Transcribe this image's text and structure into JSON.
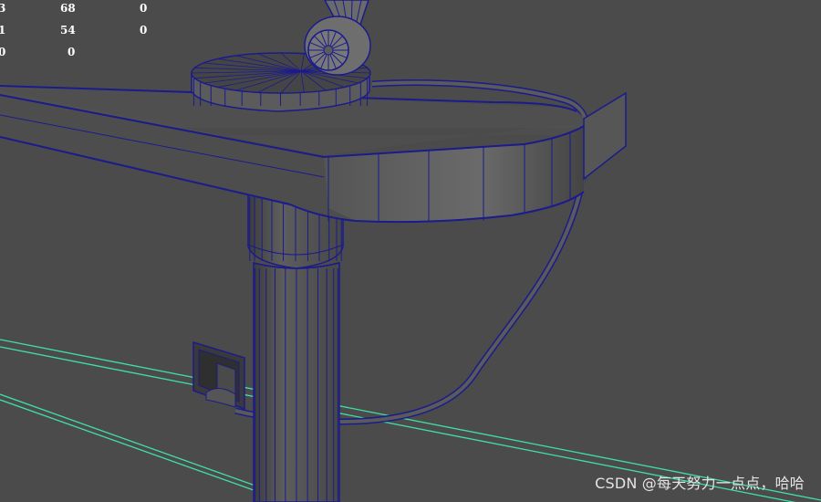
{
  "hud": {
    "rows": [
      [
        "3",
        "68",
        "0"
      ],
      [
        "1",
        "54",
        "0"
      ],
      [
        "0",
        "0"
      ]
    ]
  },
  "watermark": "CSDN @每天努力一点点，哈哈",
  "colors": {
    "background": "#4b4b4b",
    "wireframe": "#1b1b8c",
    "grid": "#3fe0a8",
    "hud_text": "#ffffff"
  }
}
